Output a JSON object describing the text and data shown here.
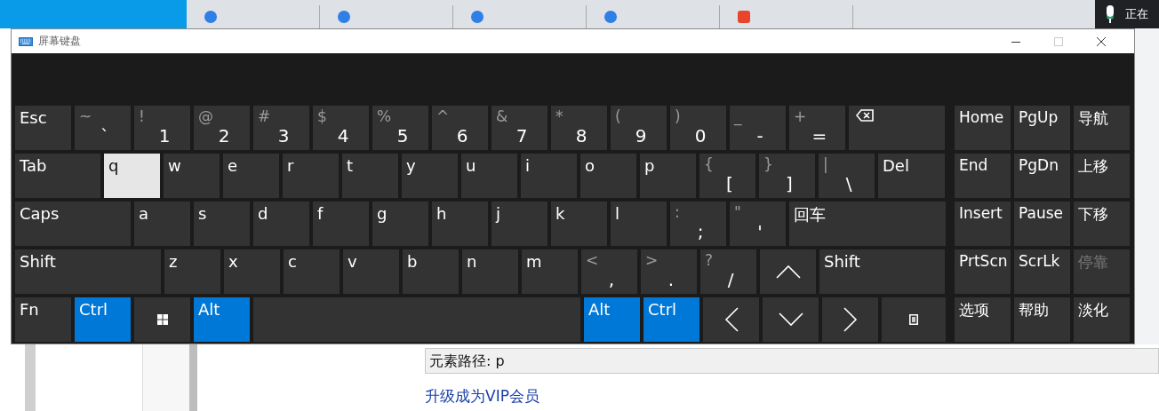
{
  "window": {
    "title": "屏幕键盘"
  },
  "keyboard": {
    "rows": [
      [
        {
          "kind": "key",
          "label": "Esc",
          "on": false,
          "hovered": false
        },
        {
          "kind": "char",
          "shift": "~",
          "label": "`",
          "on": false,
          "hovered": false
        },
        {
          "kind": "char",
          "shift": "!",
          "label": "1",
          "on": false,
          "hovered": false
        },
        {
          "kind": "char",
          "shift": "@",
          "label": "2",
          "on": false,
          "hovered": false
        },
        {
          "kind": "char",
          "shift": "#",
          "label": "3",
          "on": false,
          "hovered": false
        },
        {
          "kind": "char",
          "shift": "$",
          "label": "4",
          "on": false,
          "hovered": false
        },
        {
          "kind": "char",
          "shift": "%",
          "label": "5",
          "on": false,
          "hovered": false
        },
        {
          "kind": "char",
          "shift": "^",
          "label": "6",
          "on": false,
          "hovered": false
        },
        {
          "kind": "char",
          "shift": "&",
          "label": "7",
          "on": false,
          "hovered": false
        },
        {
          "kind": "char",
          "shift": "*",
          "label": "8",
          "on": false,
          "hovered": false
        },
        {
          "kind": "char",
          "shift": "(",
          "label": "9",
          "on": false,
          "hovered": false
        },
        {
          "kind": "char",
          "shift": ")",
          "label": "0",
          "on": false,
          "hovered": false
        },
        {
          "kind": "char",
          "shift": "_",
          "label": "-",
          "on": false,
          "hovered": false
        },
        {
          "kind": "char",
          "shift": "+",
          "label": "=",
          "on": false,
          "hovered": false
        },
        {
          "kind": "backspace",
          "on": false,
          "hovered": false
        }
      ],
      [
        {
          "kind": "key",
          "label": "Tab",
          "on": false,
          "hovered": false
        },
        {
          "kind": "key",
          "label": "q",
          "on": false,
          "hovered": true
        },
        {
          "kind": "key",
          "label": "w",
          "on": false,
          "hovered": false
        },
        {
          "kind": "key",
          "label": "e",
          "on": false,
          "hovered": false
        },
        {
          "kind": "key",
          "label": "r",
          "on": false,
          "hovered": false
        },
        {
          "kind": "key",
          "label": "t",
          "on": false,
          "hovered": false
        },
        {
          "kind": "key",
          "label": "y",
          "on": false,
          "hovered": false
        },
        {
          "kind": "key",
          "label": "u",
          "on": false,
          "hovered": false
        },
        {
          "kind": "key",
          "label": "i",
          "on": false,
          "hovered": false
        },
        {
          "kind": "key",
          "label": "o",
          "on": false,
          "hovered": false
        },
        {
          "kind": "key",
          "label": "p",
          "on": false,
          "hovered": false
        },
        {
          "kind": "char",
          "shift": "{",
          "label": "[",
          "on": false,
          "hovered": false
        },
        {
          "kind": "char",
          "shift": "}",
          "label": "]",
          "on": false,
          "hovered": false
        },
        {
          "kind": "char",
          "shift": "|",
          "label": "\\",
          "on": false,
          "hovered": false
        },
        {
          "kind": "key",
          "label": "Del",
          "on": false,
          "hovered": false
        }
      ],
      [
        {
          "kind": "key",
          "label": "Caps",
          "on": false,
          "hovered": false
        },
        {
          "kind": "key",
          "label": "a",
          "on": false,
          "hovered": false
        },
        {
          "kind": "key",
          "label": "s",
          "on": false,
          "hovered": false
        },
        {
          "kind": "key",
          "label": "d",
          "on": false,
          "hovered": false
        },
        {
          "kind": "key",
          "label": "f",
          "on": false,
          "hovered": false
        },
        {
          "kind": "key",
          "label": "g",
          "on": false,
          "hovered": false
        },
        {
          "kind": "key",
          "label": "h",
          "on": false,
          "hovered": false
        },
        {
          "kind": "key",
          "label": "j",
          "on": false,
          "hovered": false
        },
        {
          "kind": "key",
          "label": "k",
          "on": false,
          "hovered": false
        },
        {
          "kind": "key",
          "label": "l",
          "on": false,
          "hovered": false
        },
        {
          "kind": "char",
          "shift": ":",
          "label": ";",
          "on": false,
          "hovered": false
        },
        {
          "kind": "char",
          "shift": "\"",
          "label": "'",
          "on": false,
          "hovered": false
        },
        {
          "kind": "key",
          "label": "回车",
          "on": false,
          "hovered": false
        }
      ],
      [
        {
          "kind": "key",
          "label": "Shift",
          "on": false,
          "hovered": false
        },
        {
          "kind": "key",
          "label": "z",
          "on": false,
          "hovered": false
        },
        {
          "kind": "key",
          "label": "x",
          "on": false,
          "hovered": false
        },
        {
          "kind": "key",
          "label": "c",
          "on": false,
          "hovered": false
        },
        {
          "kind": "key",
          "label": "v",
          "on": false,
          "hovered": false
        },
        {
          "kind": "key",
          "label": "b",
          "on": false,
          "hovered": false
        },
        {
          "kind": "key",
          "label": "n",
          "on": false,
          "hovered": false
        },
        {
          "kind": "key",
          "label": "m",
          "on": false,
          "hovered": false
        },
        {
          "kind": "char",
          "shift": "<",
          "label": ",",
          "on": false,
          "hovered": false
        },
        {
          "kind": "char",
          "shift": ">",
          "label": ".",
          "on": false,
          "hovered": false
        },
        {
          "kind": "char",
          "shift": "?",
          "label": "/",
          "on": false,
          "hovered": false
        },
        {
          "kind": "up",
          "on": false,
          "hovered": false
        },
        {
          "kind": "key",
          "label": "Shift",
          "on": false,
          "hovered": false
        }
      ],
      [
        {
          "kind": "key",
          "label": "Fn",
          "on": false,
          "hovered": false
        },
        {
          "kind": "key",
          "label": "Ctrl",
          "on": true,
          "hovered": false
        },
        {
          "kind": "windows",
          "on": false,
          "hovered": false
        },
        {
          "kind": "key",
          "label": "Alt",
          "on": true,
          "hovered": false
        },
        {
          "kind": "space",
          "on": false,
          "hovered": false
        },
        {
          "kind": "key",
          "label": "Alt",
          "on": true,
          "hovered": false
        },
        {
          "kind": "key",
          "label": "Ctrl",
          "on": true,
          "hovered": false
        },
        {
          "kind": "left",
          "on": false,
          "hovered": false
        },
        {
          "kind": "down",
          "on": false,
          "hovered": false
        },
        {
          "kind": "right",
          "on": false,
          "hovered": false
        },
        {
          "kind": "menu",
          "on": false,
          "hovered": false
        }
      ]
    ],
    "side_keys": [
      {
        "label": "Home",
        "disabled": false
      },
      {
        "label": "PgUp",
        "disabled": false
      },
      {
        "label": "导航",
        "disabled": false
      },
      {
        "label": "End",
        "disabled": false
      },
      {
        "label": "PgDn",
        "disabled": false
      },
      {
        "label": "上移",
        "disabled": false
      },
      {
        "label": "Insert",
        "disabled": false
      },
      {
        "label": "Pause",
        "disabled": false
      },
      {
        "label": "下移",
        "disabled": false
      },
      {
        "label": "PrtScn",
        "disabled": false
      },
      {
        "label": "ScrLk",
        "disabled": false
      },
      {
        "label": "停靠",
        "disabled": true
      },
      {
        "label": "选项",
        "disabled": false
      },
      {
        "label": "帮助",
        "disabled": false
      },
      {
        "label": "淡化",
        "disabled": false
      }
    ]
  },
  "browser": {
    "tray_text": "正在",
    "element_path": "元素路径: p",
    "upgrade_link": "升级成为VIP会员"
  }
}
